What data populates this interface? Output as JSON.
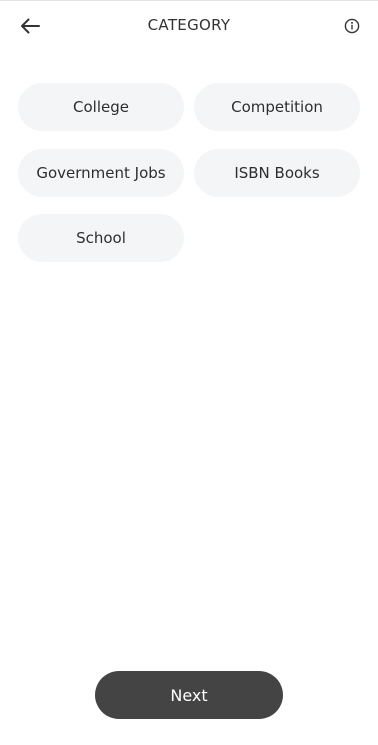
{
  "header": {
    "title": "CATEGORY",
    "back_icon": "arrow-left-icon",
    "info_icon": "info-circle-icon"
  },
  "categories": [
    {
      "label": "College"
    },
    {
      "label": "Competition"
    },
    {
      "label": "Government Jobs"
    },
    {
      "label": "ISBN Books"
    },
    {
      "label": "School"
    }
  ],
  "footer": {
    "next_label": "Next"
  },
  "colors": {
    "chip_background": "#f4f5f7",
    "button_background": "#444444",
    "text": "#2e2e2e"
  }
}
